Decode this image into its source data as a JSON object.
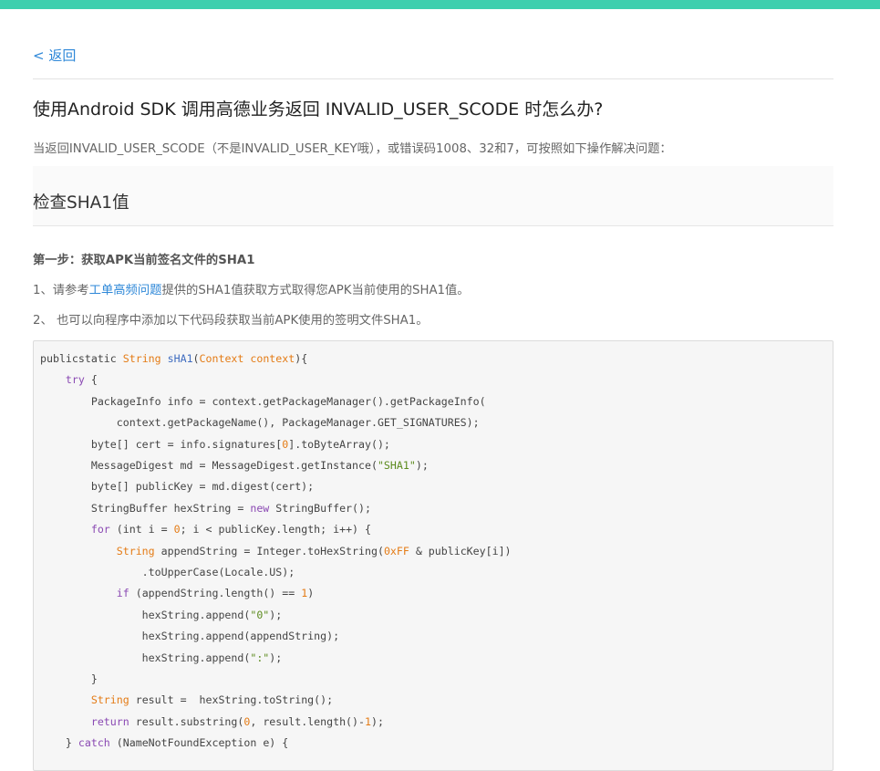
{
  "colors": {
    "top_bar": "#3ecfae",
    "link": "#2f88d8",
    "keyword": "#8a49b3",
    "type": "#e47b15",
    "string": "#5c8b1e"
  },
  "nav": {
    "back_label": "< 返回"
  },
  "article": {
    "title": "使用Android SDK 调用高德业务返回 INVALID_USER_SCODE 时怎么办?",
    "intro": "当返回INVALID_USER_SCODE（不是INVALID_USER_KEY哦），或错误码1008、32和7，可按照如下操作解决问题：",
    "section_heading": "检查SHA1值",
    "step1_heading": "第一步：获取APK当前签名文件的SHA1",
    "item1_prefix": "1、请参考",
    "item1_link": "工单高频问题",
    "item1_suffix": "提供的SHA1值获取方式取得您APK当前使用的SHA1值。",
    "item2": "2、 也可以向程序中添加以下代码段获取当前APK使用的签明文件SHA1。"
  },
  "code": {
    "lines": [
      [
        [
          "t",
          "publicstatic "
        ],
        [
          "ty",
          "String "
        ],
        [
          "fn",
          "sHA1"
        ],
        [
          "t",
          "("
        ],
        [
          "ty",
          "Context context"
        ],
        [
          "t",
          "){"
        ]
      ],
      [
        [
          "t",
          "    "
        ],
        [
          "kw",
          "try"
        ],
        [
          "t",
          " {"
        ]
      ],
      [
        [
          "t",
          "        PackageInfo info = context.getPackageManager().getPackageInfo("
        ]
      ],
      [
        [
          "t",
          "            context.getPackageName(), PackageManager.GET_SIGNATURES);"
        ]
      ],
      [
        [
          "t",
          "        byte[] cert = info.signatures["
        ],
        [
          "num",
          "0"
        ],
        [
          "t",
          "].toByteArray();"
        ]
      ],
      [
        [
          "t",
          "        MessageDigest md = MessageDigest.getInstance("
        ],
        [
          "str",
          "\"SHA1\""
        ],
        [
          "t",
          ");"
        ]
      ],
      [
        [
          "t",
          "        byte[] publicKey = md.digest(cert);"
        ]
      ],
      [
        [
          "t",
          "        StringBuffer hexString = "
        ],
        [
          "kw",
          "new"
        ],
        [
          "t",
          " StringBuffer();"
        ]
      ],
      [
        [
          "t",
          "        "
        ],
        [
          "kw",
          "for"
        ],
        [
          "t",
          " (int i = "
        ],
        [
          "num",
          "0"
        ],
        [
          "t",
          "; i < publicKey.length; i++) {"
        ]
      ],
      [
        [
          "t",
          "            "
        ],
        [
          "ty",
          "String"
        ],
        [
          "t",
          " appendString = Integer.toHexString("
        ],
        [
          "num",
          "0xFF"
        ],
        [
          "t",
          " & publicKey[i])"
        ]
      ],
      [
        [
          "t",
          "                .toUpperCase(Locale.US);"
        ]
      ],
      [
        [
          "t",
          "            "
        ],
        [
          "kw",
          "if"
        ],
        [
          "t",
          " (appendString.length() == "
        ],
        [
          "num",
          "1"
        ],
        [
          "t",
          ")"
        ]
      ],
      [
        [
          "t",
          "                hexString.append("
        ],
        [
          "str",
          "\"0\""
        ],
        [
          "t",
          ");"
        ]
      ],
      [
        [
          "t",
          "                hexString.append(appendString);"
        ]
      ],
      [
        [
          "t",
          "                hexString.append("
        ],
        [
          "str",
          "\":\""
        ],
        [
          "t",
          ");"
        ]
      ],
      [
        [
          "t",
          "        }"
        ]
      ],
      [
        [
          "t",
          "        "
        ],
        [
          "ty",
          "String"
        ],
        [
          "t",
          " result =  hexString.toString();"
        ]
      ],
      [
        [
          "t",
          "        "
        ],
        [
          "kw",
          "return"
        ],
        [
          "t",
          " result.substring("
        ],
        [
          "num",
          "0"
        ],
        [
          "t",
          ", result.length()-"
        ],
        [
          "num",
          "1"
        ],
        [
          "t",
          ");"
        ]
      ],
      [
        [
          "t",
          "    } "
        ],
        [
          "kw",
          "catch"
        ],
        [
          "t",
          " (NameNotFoundException e) {"
        ]
      ]
    ]
  }
}
